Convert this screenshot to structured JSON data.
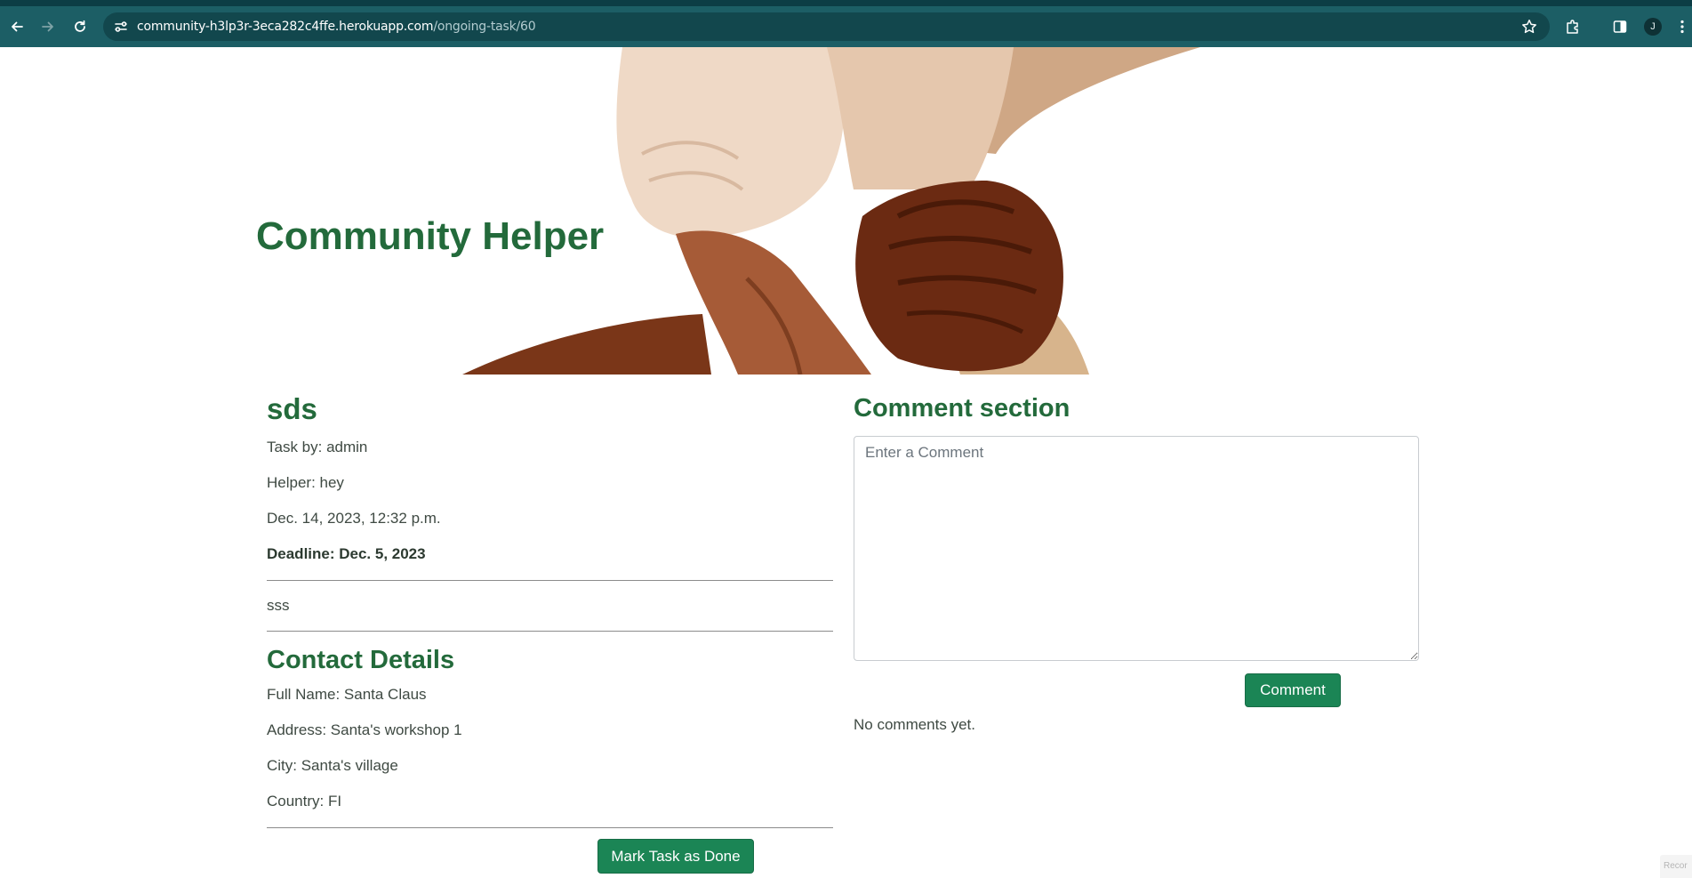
{
  "browser": {
    "url_host": "community-h3lp3r-3eca282c4ffe.herokuapp.com",
    "url_path": "/ongoing-task/60",
    "profile_initial": "J",
    "icons": [
      "back-arrow-icon",
      "forward-arrow-icon",
      "reload-icon",
      "site-settings-icon",
      "star-icon",
      "extensions-icon",
      "side-panel-icon",
      "kebab-menu-icon"
    ]
  },
  "site": {
    "title": "Community Helper"
  },
  "task": {
    "title": "sds",
    "task_by": "Task by: admin",
    "helper": "Helper: hey",
    "created": "Dec. 14, 2023, 12:32 p.m.",
    "deadline": "Deadline: Dec. 5, 2023",
    "description": "sss",
    "mark_done_label": "Mark Task as Done"
  },
  "contact": {
    "heading": "Contact Details",
    "full_name": "Full Name: Santa Claus",
    "address": "Address: Santa's workshop 1",
    "city": "City: Santa's village",
    "country": "Country: FI"
  },
  "comments": {
    "heading": "Comment section",
    "placeholder": "Enter a Comment",
    "submit_label": "Comment",
    "empty_text": "No comments yet."
  },
  "colors": {
    "brand_green": "#236a3b",
    "button_green": "#1b8555",
    "chrome_toolbar": "#1c5e65"
  }
}
